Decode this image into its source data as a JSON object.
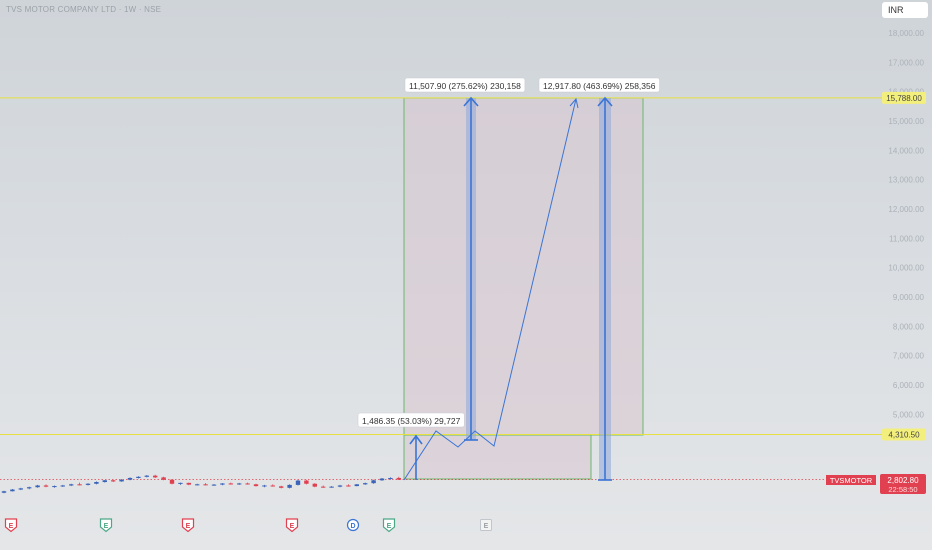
{
  "header": {
    "title": "TVS MOTOR COMPANY LTD · 1W · NSE",
    "currency": "INR"
  },
  "colors": {
    "up": "#3b63b8",
    "down": "#e0404f",
    "level_line": "#e6e040",
    "box_stroke": "#69b86a",
    "box_fill": "#d9c6d0",
    "arrow": "#3a74d6",
    "column": "#8fa8d8"
  },
  "chart_data": {
    "type": "candlestick",
    "symbol": "TVSMOTOR",
    "price_axis": {
      "ticks": [
        "18,000.00",
        "17,000.00",
        "16,000.00",
        "15,000.00",
        "14,000.00",
        "13,000.00",
        "12,000.00",
        "11,000.00",
        "10,000.00",
        "9,000.00",
        "8,000.00",
        "7,000.00",
        "6,000.00",
        "5,000.00"
      ],
      "tick_values": [
        18000,
        17000,
        16000,
        15000,
        14000,
        13000,
        12000,
        11000,
        10000,
        9000,
        8000,
        7000,
        6000,
        5000
      ],
      "ylim": [
        2300,
        18500
      ]
    },
    "levels": [
      {
        "value": 15788.0,
        "label": "15,788.00"
      },
      {
        "value": 4310.5,
        "label": "4,310.50"
      }
    ],
    "last_price": {
      "symbol": "TVSMOTOR",
      "price": "2,802.80",
      "countdown": "22:58:50",
      "value": 2802.8
    },
    "projection_labels": [
      "11,507.90 (275.62%) 230,158",
      "12,917.80 (463.69%) 258,356",
      "1,486.35 (53.03%) 29,727"
    ],
    "event_markers": [
      "E",
      "E",
      "E",
      "E",
      "D",
      "E",
      "E"
    ],
    "candles": [
      [
        2350,
        2420,
        2330,
        2400
      ],
      [
        2400,
        2480,
        2390,
        2460
      ],
      [
        2460,
        2520,
        2440,
        2500
      ],
      [
        2500,
        2560,
        2470,
        2540
      ],
      [
        2540,
        2620,
        2520,
        2600
      ],
      [
        2600,
        2640,
        2540,
        2560
      ],
      [
        2560,
        2600,
        2520,
        2580
      ],
      [
        2580,
        2620,
        2550,
        2600
      ],
      [
        2600,
        2660,
        2580,
        2640
      ],
      [
        2640,
        2700,
        2610,
        2620
      ],
      [
        2620,
        2680,
        2600,
        2660
      ],
      [
        2660,
        2740,
        2640,
        2720
      ],
      [
        2720,
        2790,
        2700,
        2780
      ],
      [
        2780,
        2800,
        2720,
        2740
      ],
      [
        2740,
        2820,
        2730,
        2800
      ],
      [
        2800,
        2880,
        2780,
        2860
      ],
      [
        2860,
        2920,
        2840,
        2900
      ],
      [
        2900,
        2960,
        2880,
        2940
      ],
      [
        2940,
        2970,
        2860,
        2880
      ],
      [
        2880,
        2900,
        2780,
        2800
      ],
      [
        2800,
        2820,
        2640,
        2660
      ],
      [
        2660,
        2700,
        2620,
        2690
      ],
      [
        2690,
        2700,
        2610,
        2630
      ],
      [
        2630,
        2660,
        2600,
        2640
      ],
      [
        2640,
        2680,
        2610,
        2620
      ],
      [
        2620,
        2650,
        2590,
        2630
      ],
      [
        2630,
        2680,
        2610,
        2670
      ],
      [
        2670,
        2700,
        2630,
        2650
      ],
      [
        2650,
        2690,
        2620,
        2670
      ],
      [
        2670,
        2700,
        2630,
        2640
      ],
      [
        2640,
        2660,
        2560,
        2580
      ],
      [
        2580,
        2620,
        2540,
        2600
      ],
      [
        2600,
        2640,
        2560,
        2570
      ],
      [
        2570,
        2590,
        2500,
        2520
      ],
      [
        2520,
        2640,
        2500,
        2620
      ],
      [
        2620,
        2790,
        2600,
        2770
      ],
      [
        2770,
        2800,
        2640,
        2660
      ],
      [
        2660,
        2680,
        2540,
        2560
      ],
      [
        2560,
        2600,
        2520,
        2540
      ],
      [
        2540,
        2580,
        2520,
        2560
      ],
      [
        2560,
        2620,
        2540,
        2600
      ],
      [
        2600,
        2640,
        2560,
        2580
      ],
      [
        2580,
        2650,
        2570,
        2640
      ],
      [
        2640,
        2700,
        2620,
        2680
      ],
      [
        2680,
        2800,
        2660,
        2780
      ],
      [
        2780,
        2860,
        2760,
        2840
      ],
      [
        2840,
        2880,
        2800,
        2860
      ],
      [
        2860,
        2900,
        2790,
        2803
      ]
    ]
  }
}
